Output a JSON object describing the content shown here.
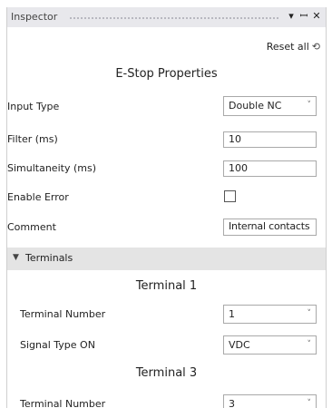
{
  "panel": {
    "title": "Inspector",
    "icons": [
      "dropdown-arrow-icon",
      "pin-icon",
      "close-icon"
    ],
    "reset_label": "Reset all"
  },
  "properties": {
    "title": "E-Stop Properties",
    "input_type": {
      "label": "Input Type",
      "value": "Double NC"
    },
    "filter": {
      "label": "Filter (ms)",
      "value": "10"
    },
    "simultaneity": {
      "label": "Simultaneity (ms)",
      "value": "100"
    },
    "enable_error": {
      "label": "Enable Error",
      "checked": false
    },
    "comment": {
      "label": "Comment",
      "value": "Internal contacts"
    }
  },
  "terminals": {
    "section_label": "Terminals",
    "groups": [
      {
        "title": "Terminal 1",
        "terminal_number": {
          "label": "Terminal Number",
          "value": "1"
        },
        "signal_type_on": {
          "label": "Signal Type ON",
          "value": "VDC"
        }
      },
      {
        "title": "Terminal 3",
        "terminal_number": {
          "label": "Terminal Number",
          "value": "3"
        }
      }
    ]
  }
}
